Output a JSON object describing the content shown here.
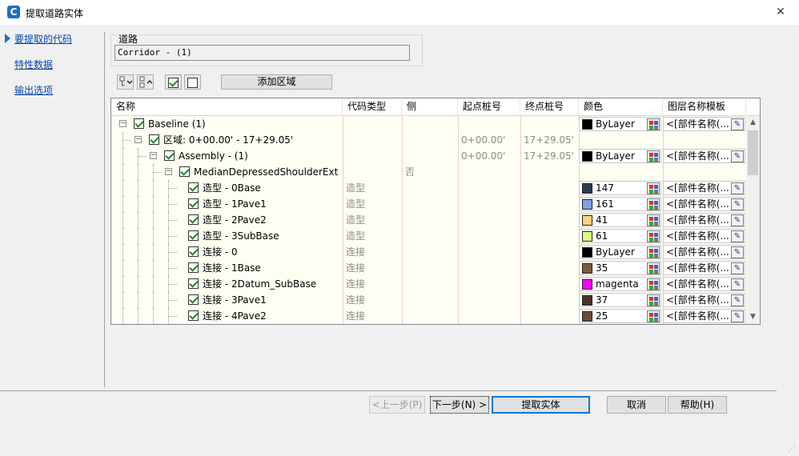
{
  "window": {
    "title": "提取道路实体",
    "app_icon_letter": "C",
    "close": "✕"
  },
  "nav": {
    "items": [
      {
        "label": "要提取的代码"
      },
      {
        "label": "特性数据"
      },
      {
        "label": "输出选项"
      }
    ]
  },
  "road": {
    "group_label": "道路",
    "value": "Corridor - (1)"
  },
  "toolbar": {
    "add_region": "添加区域"
  },
  "grid": {
    "headers": [
      "名称",
      "代码类型",
      "侧",
      "起点桩号",
      "终点桩号",
      "颜色",
      "图层名称模板"
    ],
    "rows": [
      {
        "name": "Baseline (1)",
        "level": 0,
        "toggle": "−",
        "type": "",
        "side": "",
        "start": "",
        "end": "",
        "color": "ByLayer",
        "swatch": "#000000",
        "layer": "<[部件名称(..."
      },
      {
        "name": "区域: 0+00.00' - 17+29.05'",
        "level": 1,
        "toggle": "−",
        "type": "",
        "side": "",
        "start": "0+00.00'",
        "end": "17+29.05'",
        "color": "",
        "swatch": "",
        "layer": ""
      },
      {
        "name": "Assembly - (1)",
        "level": 2,
        "toggle": "−",
        "type": "",
        "side": "",
        "start": "0+00.00'",
        "end": "17+29.05'",
        "color": "ByLayer",
        "swatch": "#000000",
        "layer": "<[部件名称(..."
      },
      {
        "name": "MedianDepressedShoulderExt",
        "level": 3,
        "toggle": "−",
        "type": "",
        "side": "否",
        "start": "",
        "end": "",
        "color": "",
        "swatch": "",
        "layer": ""
      },
      {
        "name": "造型 - 0Base",
        "level": 4,
        "toggle": "",
        "type": "造型",
        "side": "",
        "start": "",
        "end": "",
        "color": "147",
        "swatch": "#2a3f52",
        "layer": "<[部件名称(..."
      },
      {
        "name": "造型 - 1Pave1",
        "level": 4,
        "toggle": "",
        "type": "造型",
        "side": "",
        "start": "",
        "end": "",
        "color": "161",
        "swatch": "#7f9fe6",
        "layer": "<[部件名称(..."
      },
      {
        "name": "造型 - 2Pave2",
        "level": 4,
        "toggle": "",
        "type": "造型",
        "side": "",
        "start": "",
        "end": "",
        "color": "41",
        "swatch": "#ffd080",
        "layer": "<[部件名称(..."
      },
      {
        "name": "造型 - 3SubBase",
        "level": 4,
        "toggle": "",
        "type": "造型",
        "side": "",
        "start": "",
        "end": "",
        "color": "61",
        "swatch": "#e0ff80",
        "layer": "<[部件名称(..."
      },
      {
        "name": "连接 - 0",
        "level": 4,
        "toggle": "",
        "type": "连接",
        "side": "",
        "start": "",
        "end": "",
        "color": "ByLayer",
        "swatch": "#000000",
        "layer": "<[部件名称(..."
      },
      {
        "name": "连接 - 1Base",
        "level": 4,
        "toggle": "",
        "type": "连接",
        "side": "",
        "start": "",
        "end": "",
        "color": "35",
        "swatch": "#7a5a3a",
        "layer": "<[部件名称(..."
      },
      {
        "name": "连接 - 2Datum_SubBase",
        "level": 4,
        "toggle": "",
        "type": "连接",
        "side": "",
        "start": "",
        "end": "",
        "color": "magenta",
        "swatch": "#ff00ff",
        "layer": "<[部件名称(..."
      },
      {
        "name": "连接 - 3Pave1",
        "level": 4,
        "toggle": "",
        "type": "连接",
        "side": "",
        "start": "",
        "end": "",
        "color": "37",
        "swatch": "#4a3626",
        "layer": "<[部件名称(..."
      },
      {
        "name": "连接 - 4Pave2",
        "level": 4,
        "toggle": "",
        "type": "连接",
        "side": "",
        "start": "",
        "end": "",
        "color": "25",
        "swatch": "#6e4a3a",
        "layer": "<[部件名称(..."
      }
    ]
  },
  "buttons": {
    "prev": "<上一步(P)",
    "next": "下一步(N) >",
    "extract": "提取实体",
    "cancel": "取消",
    "help": "帮助(H)"
  }
}
